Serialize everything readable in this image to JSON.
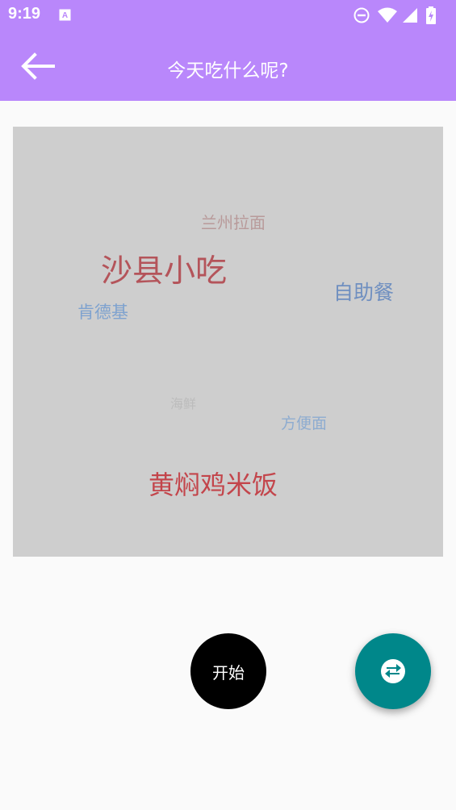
{
  "status_bar": {
    "time": "9:19",
    "icons": [
      "keyboard-a-icon",
      "do-not-disturb-icon",
      "wifi-icon",
      "cell-signal-icon",
      "battery-charging-icon"
    ]
  },
  "app_bar": {
    "title": "今天吃什么呢?",
    "back_icon": "arrow-back-icon",
    "color": "#b987fb"
  },
  "word_cloud": {
    "background": "#cecece",
    "words": [
      {
        "text": "兰州拉面",
        "color": "#b89a9a"
      },
      {
        "text": "沙县小吃",
        "color": "#b4545a"
      },
      {
        "text": "自助餐",
        "color": "#6f8fc0"
      },
      {
        "text": "肯德基",
        "color": "#7ea2cf"
      },
      {
        "text": "海鲜",
        "color": "#bcbcbc"
      },
      {
        "text": "方便面",
        "color": "#8eacd0"
      },
      {
        "text": "黄焖鸡米饭",
        "color": "#c3454b"
      }
    ]
  },
  "actions": {
    "start_label": "开始",
    "fab_icon": "swap-icon",
    "fab_color": "#00878a"
  }
}
